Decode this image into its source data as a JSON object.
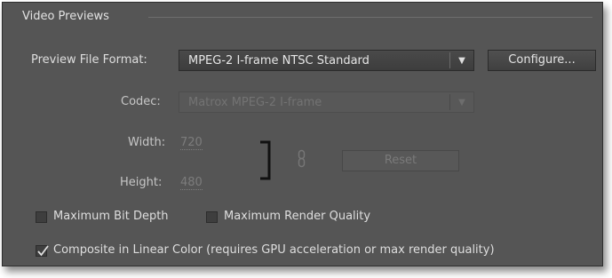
{
  "section": {
    "title": "Video Previews"
  },
  "preview_format": {
    "label": "Preview File Format:",
    "value": "MPEG-2 I-frame NTSC Standard",
    "configure_label": "Configure..."
  },
  "codec": {
    "label": "Codec:",
    "value": "Matrox MPEG-2 I-frame"
  },
  "dimensions": {
    "width_label": "Width:",
    "width_value": "720",
    "height_label": "Height:",
    "height_value": "480",
    "reset_label": "Reset"
  },
  "options": {
    "max_bit_depth": {
      "label": "Maximum Bit Depth",
      "checked": false
    },
    "max_render_quality": {
      "label": "Maximum Render Quality",
      "checked": false
    },
    "linear_color": {
      "label": "Composite in Linear Color (requires GPU acceleration or max render quality)",
      "checked": true
    }
  },
  "colors": {
    "panel_bg": "#555555",
    "text": "#dedede",
    "disabled_text": "#7a7a7a"
  }
}
